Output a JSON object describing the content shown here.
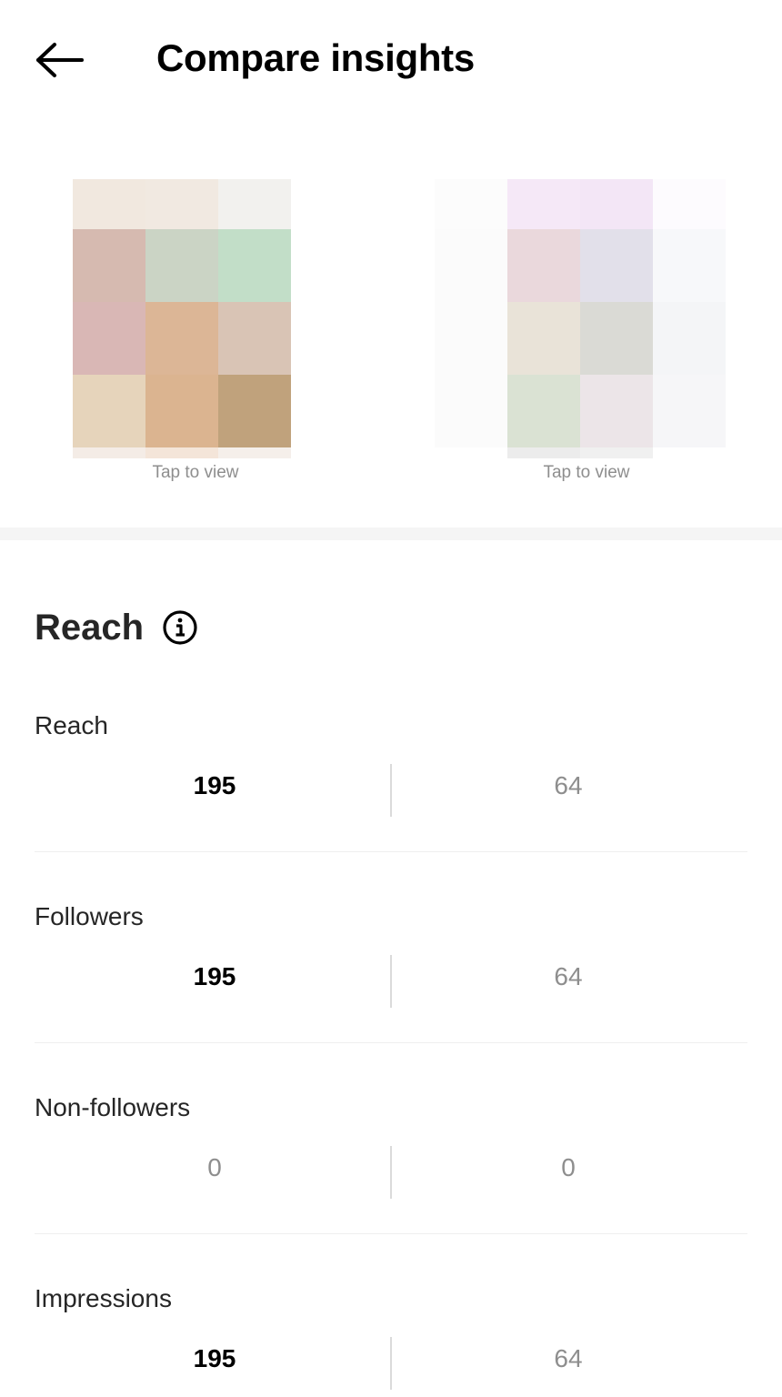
{
  "header": {
    "title": "Compare insights",
    "back_icon": "arrow-left-icon"
  },
  "posts": [
    {
      "tap_label": "Tap to view",
      "swatches": [
        [
          "#f1e8df",
          "#f1e9e1",
          "#f2f1ee"
        ],
        [
          "#d6bab0",
          "#cbd4c5",
          "#c2dec8"
        ],
        [
          "#d9b7b5",
          "#dcb696",
          "#d9c4b5"
        ],
        [
          "#e6d4bb",
          "#dbb490",
          "#c0a27c"
        ],
        [
          "#f4ece6",
          "#f4e5d9",
          "#f5efea"
        ]
      ]
    },
    {
      "tap_label": "Tap to view",
      "swatches": [
        [
          "#fcfcfc",
          "#f5e8f7",
          "#f3e6f6",
          "#fdfbfe"
        ],
        [
          "#fbfbfb",
          "#ead8dc",
          "#e2e0ea",
          "#f7f8fa"
        ],
        [
          "#fbfbfb",
          "#e9e3d8",
          "#dadad5",
          "#f4f5f7"
        ],
        [
          "#fbfbfb",
          "#dae2d3",
          "#ece5e8",
          "#f6f6f8"
        ],
        [
          "#ffffff",
          "#ececec",
          "#f0f0f0",
          "#ffffff"
        ]
      ]
    }
  ],
  "section": {
    "title": "Reach",
    "info_icon": "info-circle-icon"
  },
  "metrics": [
    {
      "label": "Reach",
      "value_a": "195",
      "value_b": "64"
    },
    {
      "label": "Followers",
      "value_a": "195",
      "value_b": "64"
    },
    {
      "label": "Non-followers",
      "value_a": "0",
      "value_b": "0"
    },
    {
      "label": "Impressions",
      "value_a": "195",
      "value_b": "64"
    }
  ]
}
